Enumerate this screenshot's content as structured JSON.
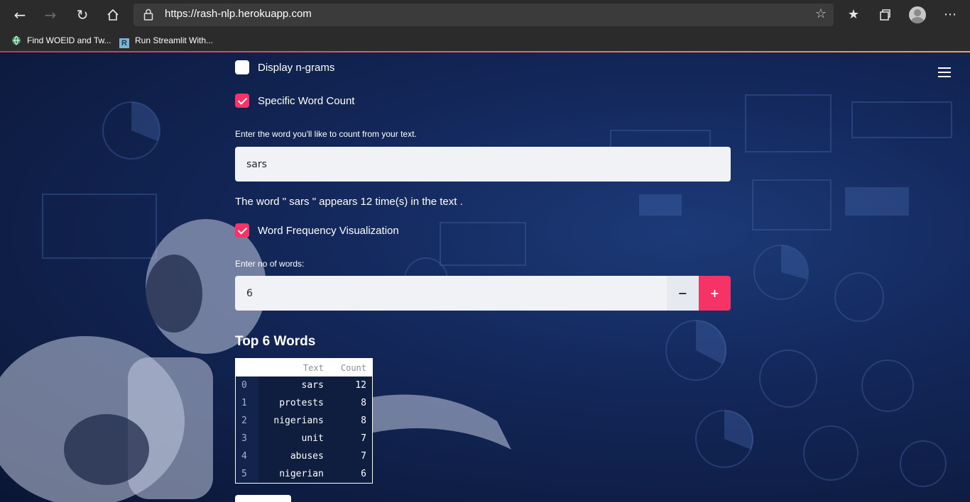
{
  "browser": {
    "url": "https://rash-nlp.herokuapp.com",
    "bookmarks": [
      {
        "label": "Find WOEID and Tw..."
      },
      {
        "label": "Run Streamlit With..."
      }
    ],
    "bookmark_favicon_letter": "R"
  },
  "app": {
    "checkbox_ngrams": {
      "label": "Display n-grams",
      "checked": false
    },
    "checkbox_wordcount": {
      "label": "Specific Word Count",
      "checked": true
    },
    "word_input": {
      "label": "Enter the word you'll like to count from your text.",
      "value": "sars"
    },
    "word_result": "The word \" sars \" appears 12 time(s) in the text .",
    "checkbox_freqviz": {
      "label": "Word Frequency Visualization",
      "checked": true
    },
    "num_input": {
      "label": "Enter no of words:",
      "value": "6",
      "minus": "−",
      "plus": "+"
    },
    "table_heading": "Top 6 Words",
    "table": {
      "columns": [
        "Text",
        "Count"
      ],
      "rows": [
        {
          "idx": "0",
          "text": "sars",
          "count": "12"
        },
        {
          "idx": "1",
          "text": "protests",
          "count": "8"
        },
        {
          "idx": "2",
          "text": "nigerians",
          "count": "8"
        },
        {
          "idx": "3",
          "text": "unit",
          "count": "7"
        },
        {
          "idx": "4",
          "text": "abuses",
          "count": "7"
        },
        {
          "idx": "5",
          "text": "nigerian",
          "count": "6"
        }
      ]
    }
  },
  "colors": {
    "accent": "#f63366",
    "input_bg": "#f0f2f6",
    "chrome_bg": "#2b2b2b"
  }
}
